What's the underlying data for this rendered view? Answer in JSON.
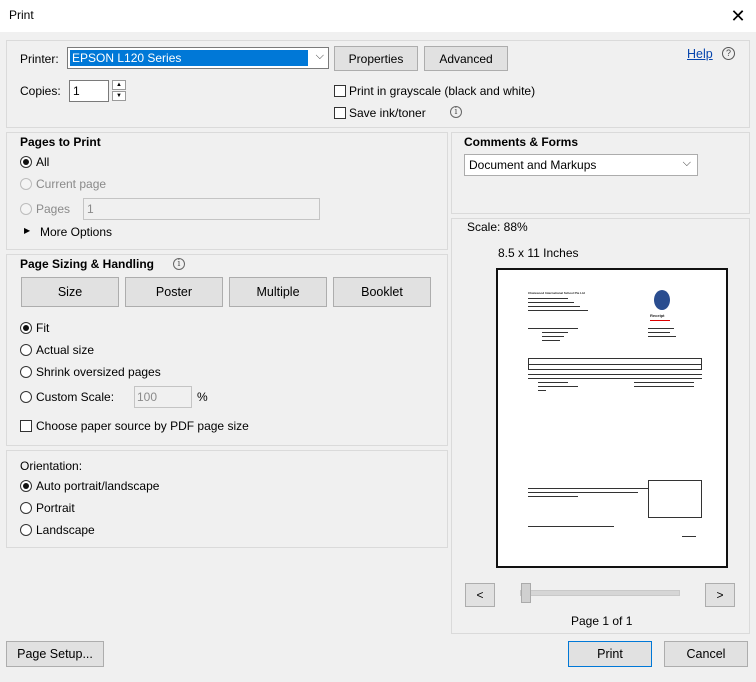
{
  "window": {
    "title": "Print"
  },
  "printer": {
    "label": "Printer:",
    "selected": "EPSON L120 Series",
    "properties_label": "Properties",
    "advanced_label": "Advanced",
    "help_label": "Help"
  },
  "copies": {
    "label": "Copies:",
    "value": "1"
  },
  "options": {
    "grayscale_label": "Print in grayscale (black and white)",
    "save_ink_label": "Save ink/toner"
  },
  "pages_to_print": {
    "heading": "Pages to Print",
    "all_label": "All",
    "current_label": "Current page",
    "pages_label": "Pages",
    "pages_value": "1",
    "more_options_label": "More Options"
  },
  "sizing": {
    "heading": "Page Sizing & Handling",
    "tabs": [
      "Size",
      "Poster",
      "Multiple",
      "Booklet"
    ],
    "fit_label": "Fit",
    "actual_label": "Actual size",
    "shrink_label": "Shrink oversized pages",
    "custom_label": "Custom Scale:",
    "custom_value": "100",
    "percent": "%",
    "paper_source_label": "Choose paper source by PDF page size"
  },
  "orientation": {
    "heading": "Orientation:",
    "auto_label": "Auto portrait/landscape",
    "portrait_label": "Portrait",
    "landscape_label": "Landscape"
  },
  "comments": {
    "heading": "Comments & Forms",
    "selected": "Document and Markups"
  },
  "preview": {
    "scale_text": "Scale:  88%",
    "paper_size": "8.5 x 11 Inches",
    "page_indicator": "Page 1 of 1",
    "prev_label": "<",
    "next_label": ">",
    "doc_school": "Chatswood International School Pte Ltd",
    "doc_receipt": "Receipt"
  },
  "footer": {
    "page_setup_label": "Page Setup...",
    "print_label": "Print",
    "cancel_label": "Cancel"
  },
  "colors": {
    "selection": "#0078d7",
    "accent_border": "#0078d7",
    "link": "#0645ad"
  }
}
